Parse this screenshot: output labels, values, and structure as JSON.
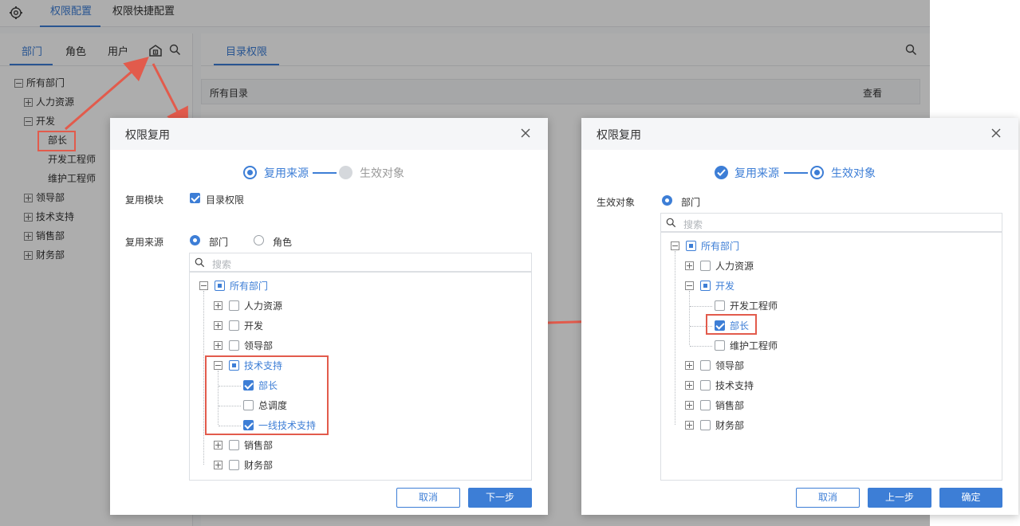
{
  "app": {
    "tabs": [
      "权限配置",
      "权限快捷配置"
    ],
    "active_tab": "权限配置"
  },
  "left_panel": {
    "tabs": [
      "部门",
      "角色",
      "用户"
    ],
    "tree": {
      "root": "所有部门",
      "items": [
        "人力资源",
        "开发",
        "部长",
        "开发工程师",
        "维护工程师",
        "领导部",
        "技术支持",
        "销售部",
        "财务部"
      ]
    }
  },
  "right_panel": {
    "tab": "目录权限",
    "header_col1": "所有目录",
    "header_col2": "查看"
  },
  "dialog1": {
    "title": "权限复用",
    "step1": "复用来源",
    "step2": "生效对象",
    "module_label": "复用模块",
    "module_option": "目录权限",
    "source_label": "复用来源",
    "radio_dept": "部门",
    "radio_role": "角色",
    "search_placeholder": "搜索",
    "tree": {
      "root": "所有部门",
      "hr": "人力资源",
      "dev": "开发",
      "lead": "领导部",
      "tech": "技术支持",
      "tech_head": "部长",
      "tech_sched": "总调度",
      "tech_front": "一线技术支持",
      "sales": "销售部",
      "finance": "财务部"
    },
    "cancel": "取消",
    "next": "下一步"
  },
  "dialog2": {
    "title": "权限复用",
    "step1": "复用来源",
    "step2": "生效对象",
    "target_label": "生效对象",
    "radio_dept": "部门",
    "search_placeholder": "搜索",
    "tree": {
      "root": "所有部门",
      "hr": "人力资源",
      "dev": "开发",
      "dev_eng": "开发工程师",
      "dev_head": "部长",
      "dev_maint": "维护工程师",
      "lead": "领导部",
      "tech": "技术支持",
      "sales": "销售部",
      "finance": "财务部"
    },
    "cancel": "取消",
    "prev": "上一步",
    "ok": "确定"
  },
  "colors": {
    "accent": "#3d7ed6",
    "highlight": "#e25b4c"
  }
}
